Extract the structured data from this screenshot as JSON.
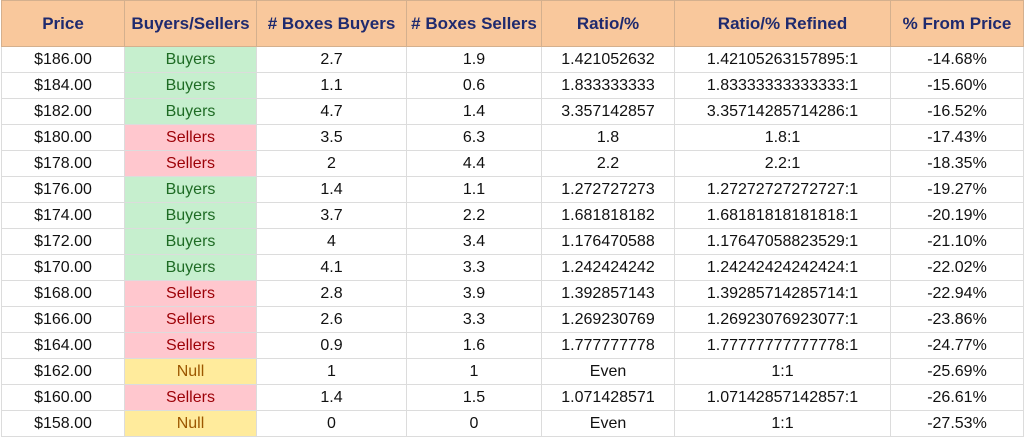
{
  "table": {
    "headers": [
      "Price",
      "Buyers/Sellers",
      "# Boxes Buyers",
      "# Boxes Sellers",
      "Ratio/%",
      "Ratio/% Refined",
      "% From Price"
    ],
    "rows": [
      {
        "price": "$186.00",
        "signal": "Buyers",
        "buyers": "2.7",
        "sellers": "1.9",
        "ratio": "1.421052632",
        "refined": "1.42105263157895:1",
        "from_price": "-14.68%"
      },
      {
        "price": "$184.00",
        "signal": "Buyers",
        "buyers": "1.1",
        "sellers": "0.6",
        "ratio": "1.833333333",
        "refined": "1.83333333333333:1",
        "from_price": "-15.60%"
      },
      {
        "price": "$182.00",
        "signal": "Buyers",
        "buyers": "4.7",
        "sellers": "1.4",
        "ratio": "3.357142857",
        "refined": "3.35714285714286:1",
        "from_price": "-16.52%"
      },
      {
        "price": "$180.00",
        "signal": "Sellers",
        "buyers": "3.5",
        "sellers": "6.3",
        "ratio": "1.8",
        "refined": "1.8:1",
        "from_price": "-17.43%"
      },
      {
        "price": "$178.00",
        "signal": "Sellers",
        "buyers": "2",
        "sellers": "4.4",
        "ratio": "2.2",
        "refined": "2.2:1",
        "from_price": "-18.35%"
      },
      {
        "price": "$176.00",
        "signal": "Buyers",
        "buyers": "1.4",
        "sellers": "1.1",
        "ratio": "1.272727273",
        "refined": "1.27272727272727:1",
        "from_price": "-19.27%"
      },
      {
        "price": "$174.00",
        "signal": "Buyers",
        "buyers": "3.7",
        "sellers": "2.2",
        "ratio": "1.681818182",
        "refined": "1.68181818181818:1",
        "from_price": "-20.19%"
      },
      {
        "price": "$172.00",
        "signal": "Buyers",
        "buyers": "4",
        "sellers": "3.4",
        "ratio": "1.176470588",
        "refined": "1.17647058823529:1",
        "from_price": "-21.10%"
      },
      {
        "price": "$170.00",
        "signal": "Buyers",
        "buyers": "4.1",
        "sellers": "3.3",
        "ratio": "1.242424242",
        "refined": "1.24242424242424:1",
        "from_price": "-22.02%"
      },
      {
        "price": "$168.00",
        "signal": "Sellers",
        "buyers": "2.8",
        "sellers": "3.9",
        "ratio": "1.392857143",
        "refined": "1.39285714285714:1",
        "from_price": "-22.94%"
      },
      {
        "price": "$166.00",
        "signal": "Sellers",
        "buyers": "2.6",
        "sellers": "3.3",
        "ratio": "1.269230769",
        "refined": "1.26923076923077:1",
        "from_price": "-23.86%"
      },
      {
        "price": "$164.00",
        "signal": "Sellers",
        "buyers": "0.9",
        "sellers": "1.6",
        "ratio": "1.777777778",
        "refined": "1.77777777777778:1",
        "from_price": "-24.77%"
      },
      {
        "price": "$162.00",
        "signal": "Null",
        "buyers": "1",
        "sellers": "1",
        "ratio": "Even",
        "refined": "1:1",
        "from_price": "-25.69%"
      },
      {
        "price": "$160.00",
        "signal": "Sellers",
        "buyers": "1.4",
        "sellers": "1.5",
        "ratio": "1.071428571",
        "refined": "1.07142857142857:1",
        "from_price": "-26.61%"
      },
      {
        "price": "$158.00",
        "signal": "Null",
        "buyers": "0",
        "sellers": "0",
        "ratio": "Even",
        "refined": "1:1",
        "from_price": "-27.53%"
      }
    ]
  },
  "colors": {
    "header_bg": "#f9c89c",
    "header_text": "#1f2a6e",
    "buyers_bg": "#c6efce",
    "buyers_text": "#1e6b24",
    "sellers_bg": "#ffc7ce",
    "sellers_text": "#9c0006",
    "null_bg": "#ffeb9c",
    "null_text": "#9c5700"
  }
}
